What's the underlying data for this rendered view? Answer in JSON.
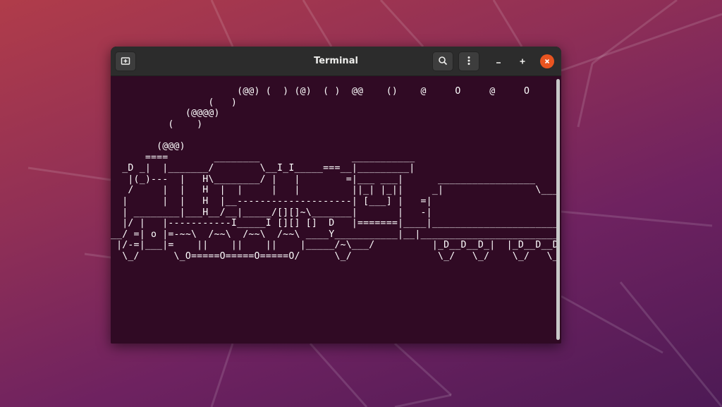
{
  "window": {
    "title": "Terminal",
    "new_tab_icon": "new-tab-icon",
    "search_icon": "search-icon",
    "menu_icon": "kebab-menu-icon",
    "minimize_label": "–",
    "maximize_label": "+",
    "close_icon": "close-icon"
  },
  "terminal": {
    "output": "                      (@@) (  ) (@)  ( )  @@    ()    @     O     @     O      @\n                 (   )\n             (@@@@)\n          (    )\n\n        (@@@)\n      ====        ________                ___________\n  _D _|  |_______/        \\__I_I_____===__|_________|\n   |(_)---  |   H\\________/ |   |        =|___ ___|      _________________\n   /     |  |   H  |  |     |   |         ||_| |_||     _|                \\_____\n  |      |  |   H  |__--------------------| [___] |   =|\n  | ________|___H__/__|_____/[][]~\\_______|       |   -|\n  |/ |   |-----------I_____I [][] []  D   |=======|____|________________________\n__/ =| o |=-~~\\  /~~\\  /~~\\  /~~\\ ____Y___________|__|__________________________\n |/-=|___|=    ||    ||    ||    |_____/~\\___/          |_D__D__D_|  |_D__D__D_|\n  \\_/      \\_O=====O=====O=====O/      \\_/               \\_/   \\_/    \\_/   \\_/"
  },
  "colors": {
    "terminal_bg": "#300a24",
    "headerbar_bg": "#2c2c2c",
    "close_button": "#e95420",
    "text": "#ffffff"
  }
}
